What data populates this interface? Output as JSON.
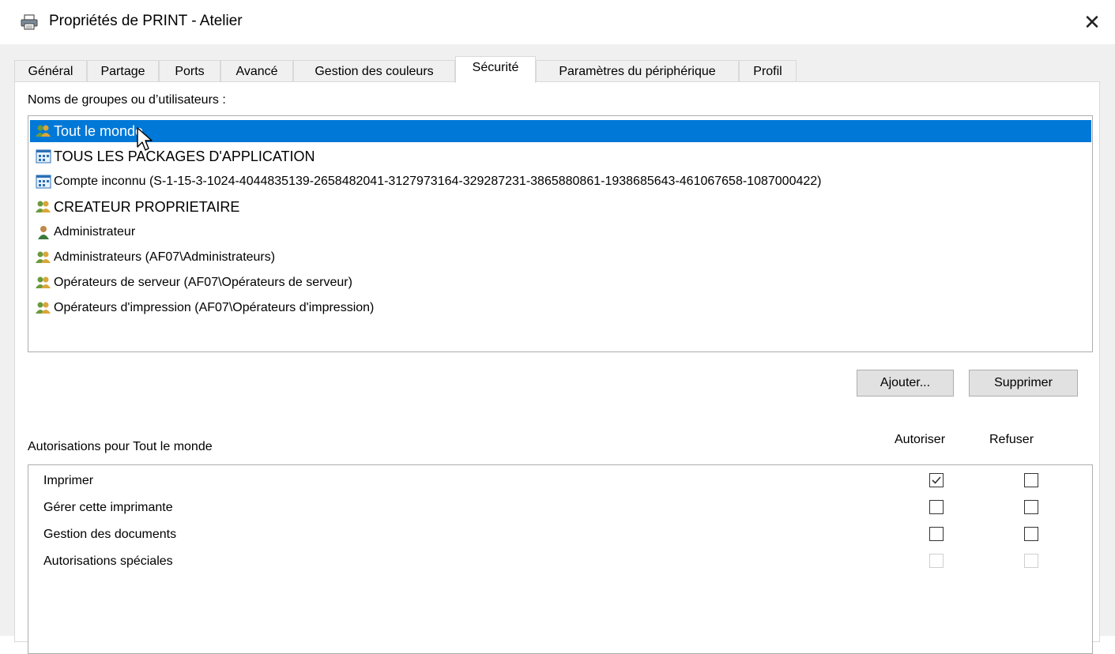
{
  "window": {
    "title": "Propriétés de PRINT - Atelier",
    "icon": "printer-icon",
    "close_glyph": "✕"
  },
  "tabs": [
    {
      "label": "Général",
      "active": false
    },
    {
      "label": "Partage",
      "active": false
    },
    {
      "label": "Ports",
      "active": false
    },
    {
      "label": "Avancé",
      "active": false
    },
    {
      "label": "Gestion des couleurs",
      "active": false
    },
    {
      "label": "Sécurité",
      "active": true
    },
    {
      "label": "Paramètres du périphérique",
      "active": false
    },
    {
      "label": "Profil",
      "active": false
    }
  ],
  "security": {
    "groups_label": "Noms de groupes ou d’utilisateurs :",
    "users": [
      {
        "label": "Tout le monde",
        "icon": "group-icon",
        "selected": true
      },
      {
        "label": "TOUS LES PACKAGES D'APPLICATION",
        "icon": "app-package-icon",
        "selected": false
      },
      {
        "label": "Compte inconnu (S-1-15-3-1024-4044835139-2658482041-3127973164-329287231-3865880861-1938685643-461067658-1087000422)",
        "icon": "app-package-icon",
        "selected": false
      },
      {
        "label": "CREATEUR PROPRIETAIRE",
        "icon": "group-icon",
        "selected": false
      },
      {
        "label": "Administrateur",
        "icon": "user-icon",
        "selected": false
      },
      {
        "label": "Administrateurs (AF07\\Administrateurs)",
        "icon": "group-icon",
        "selected": false
      },
      {
        "label": "Opérateurs de serveur (AF07\\Opérateurs de serveur)",
        "icon": "group-icon",
        "selected": false
      },
      {
        "label": "Opérateurs d'impression (AF07\\Opérateurs d'impression)",
        "icon": "group-icon",
        "selected": false
      }
    ],
    "add_button": "Ajouter...",
    "remove_button": "Supprimer",
    "permissions_label": "Autorisations pour Tout le monde",
    "allow_header": "Autoriser",
    "deny_header": "Refuser",
    "permissions": [
      {
        "label": "Imprimer",
        "allow": true,
        "deny": false,
        "enabled": true
      },
      {
        "label": "Gérer cette imprimante",
        "allow": false,
        "deny": false,
        "enabled": true
      },
      {
        "label": "Gestion des documents",
        "allow": false,
        "deny": false,
        "enabled": true
      },
      {
        "label": "Autorisations spéciales",
        "allow": false,
        "deny": false,
        "enabled": false
      }
    ]
  },
  "colors": {
    "selection": "#0078d7",
    "dialog_bg": "#f0f0f0",
    "button_bg": "#e1e1e1"
  }
}
